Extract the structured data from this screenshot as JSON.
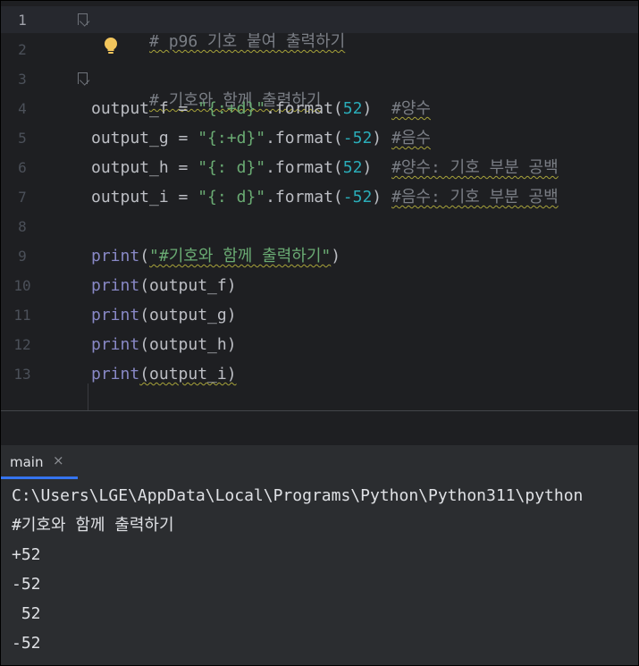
{
  "editor": {
    "line_numbers": [
      "1",
      "2",
      "3",
      "4",
      "5",
      "6",
      "7",
      "8",
      "9",
      "10",
      "11",
      "12",
      "13"
    ],
    "line1_comment": "# p96 기호 붙여 출력하기",
    "line3_comment": "# 기호와 함께 출력하기",
    "line4": {
      "var": "output_f",
      "eq": " = ",
      "str": "\"{:+d}\"",
      "call": ".format(",
      "num": "52",
      "close": ")",
      "gap": "  ",
      "comment": "#양수"
    },
    "line5": {
      "var": "output_g",
      "eq": " = ",
      "str": "\"{:+d}\"",
      "call": ".format(",
      "num": "-52",
      "close": ")",
      "gap": " ",
      "comment": "#음수"
    },
    "line6": {
      "var": "output_h",
      "eq": " = ",
      "str": "\"{: d}\"",
      "call": ".format(",
      "num": "52",
      "close": ")",
      "gap": "  ",
      "comment": "#양수: 기호 부분 공백"
    },
    "line7": {
      "var": "output_i",
      "eq": " = ",
      "str": "\"{: d}\"",
      "call": ".format(",
      "num": "-52",
      "close": ")",
      "gap": " ",
      "comment": "#음수: 기호 부분 공백"
    },
    "line9": {
      "fn": "print",
      "open": "(",
      "str": "\"#기호와 함께 출력하기\"",
      "close": ")"
    },
    "line10": {
      "fn": "print",
      "arg": "(output_f)"
    },
    "line11": {
      "fn": "print",
      "arg": "(output_g)"
    },
    "line12": {
      "fn": "print",
      "arg": "(output_h)"
    },
    "line13": {
      "fn": "print",
      "arg": "(output_i)"
    }
  },
  "run_panel": {
    "tab_label": "main",
    "close_glyph": "×",
    "console_lines": [
      "C:\\Users\\LGE\\AppData\\Local\\Programs\\Python\\Python311\\python",
      "#기호와 함께 출력하기",
      "+52",
      "-52",
      " 52",
      "-52"
    ]
  },
  "colors": {
    "background": "#1e1f22",
    "comment": "#7a7e85",
    "string": "#6aab73",
    "number": "#2aacb8",
    "builtin": "#8888c6",
    "tab_underline": "#3574f0"
  },
  "icons": [
    "lightbulb-icon",
    "fold-icon",
    "close-icon"
  ]
}
